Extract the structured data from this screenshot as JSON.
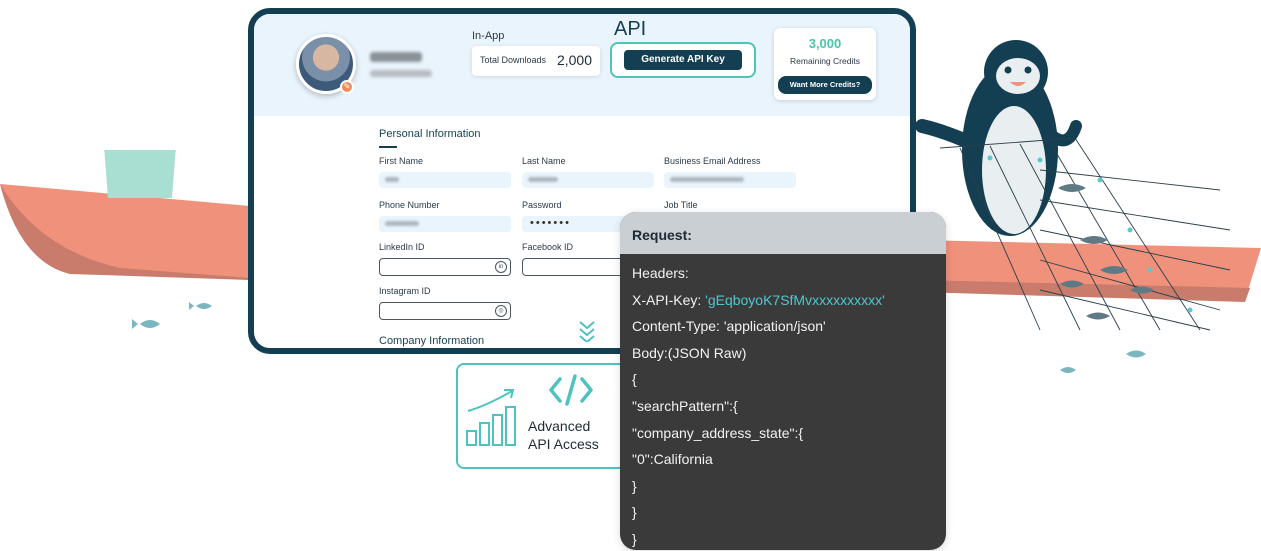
{
  "profile": {
    "name_blurred": true
  },
  "stats": {
    "inapp_label": "In-App",
    "downloads_label": "Total Downloads",
    "downloads_value": "2,000"
  },
  "api": {
    "title": "API",
    "generate_button": "Generate API Key"
  },
  "credits": {
    "value": "3,000",
    "label": "Remaining Credits",
    "button": "Want More Credits?"
  },
  "personal_section": {
    "title": "Personal Information",
    "first_name_label": "First Name",
    "last_name_label": "Last Name",
    "business_email_label": "Business Email Address",
    "phone_label": "Phone Number",
    "password_label": "Password",
    "password_mask": "•••••••",
    "job_title_label": "Job Title",
    "linkedin_label": "LinkedIn ID",
    "facebook_label": "Facebook ID",
    "instagram_label": "Instagram ID"
  },
  "company_section": {
    "title": "Company Information"
  },
  "feature": {
    "line1": "Advanced",
    "line2": "API Access",
    "icons": [
      "code-icon",
      "growth-chart-icon"
    ]
  },
  "request": {
    "title": "Request:",
    "headers_label": "Headers:",
    "api_key_label": "X-API-Key:",
    "api_key_value": "'gEqboyoK7SfMvxxxxxxxxxx'",
    "content_type": "Content-Type: 'application/json'",
    "body_label": "Body:(JSON Raw)",
    "brace_open": "{",
    "search_pattern": "\"searchPattern\":{",
    "address_state": "\"company_address_state\":{",
    "value_entry": "\"0\":California",
    "close1": "}",
    "close2": "}",
    "close3": "}"
  },
  "colors": {
    "navy": "#143f52",
    "teal": "#4fc2c0",
    "credit_green": "#48c6a8",
    "header_bg": "#eaf4fc",
    "boat": "#f0917c",
    "code_bg": "#3a3a3a"
  }
}
